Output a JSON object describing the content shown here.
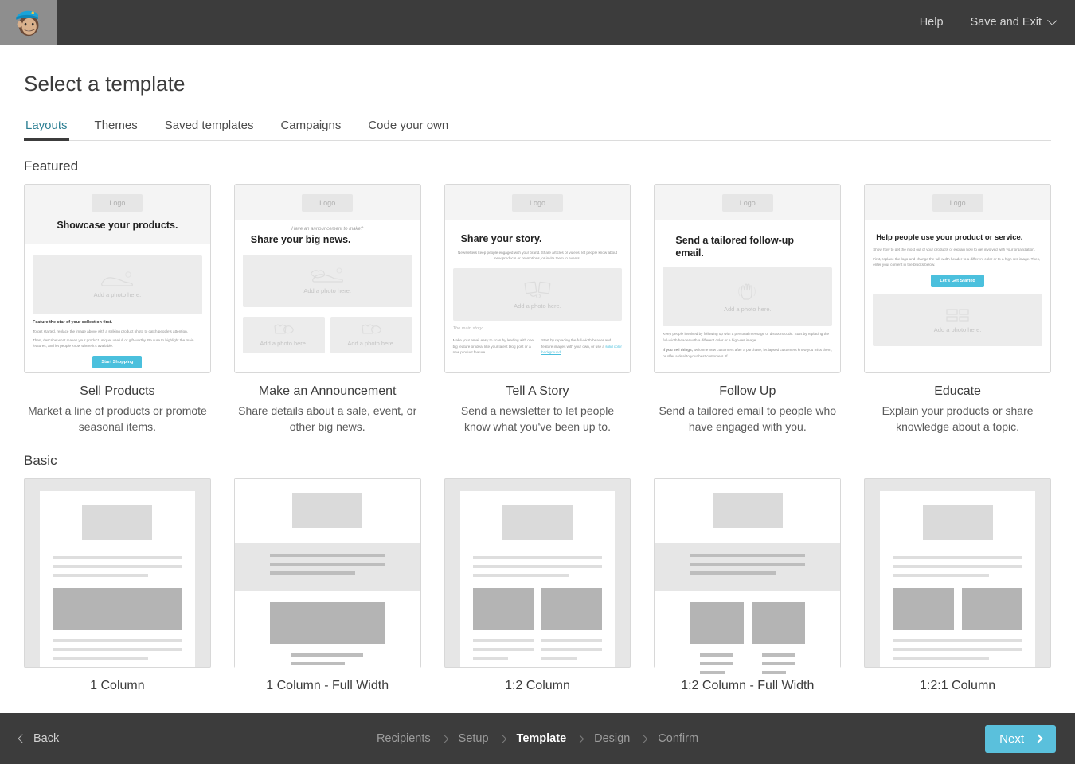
{
  "header": {
    "logo_icon": "mailchimp-freddie-logo",
    "help_label": "Help",
    "save_exit_label": "Save and Exit"
  },
  "page_title": "Select a template",
  "tabs": [
    {
      "label": "Layouts",
      "active": true
    },
    {
      "label": "Themes",
      "active": false
    },
    {
      "label": "Saved templates",
      "active": false
    },
    {
      "label": "Campaigns",
      "active": false
    },
    {
      "label": "Code your own",
      "active": false
    }
  ],
  "sections": {
    "featured": {
      "title": "Featured",
      "items": [
        {
          "name": "Sell Products",
          "description": "Market a line of products or promote seasonal items.",
          "preview": {
            "logo": "Logo",
            "eyebrow": "",
            "headline": "Showcase your products.",
            "photo_caption": "Add a photo here.",
            "body_heading": "Feature the star of your collection first.",
            "body_1": "To get started, replace the image above with a striking product photo to catch people's attention.",
            "body_2": "Then, describe what makes your product unique, useful, or gift-worthy. Be sure to highlight the main features, and let people know where it's available.",
            "button": "Start Shopping"
          }
        },
        {
          "name": "Make an Announcement",
          "description": "Share details about a sale, event, or other big news.",
          "preview": {
            "logo": "Logo",
            "eyebrow": "Have an announcement to make?",
            "headline": "Share your big news.",
            "photo_caption": "Add a photo here.",
            "photo_caption_left": "Add a photo here.",
            "photo_caption_right": "Add a photo here."
          }
        },
        {
          "name": "Tell A Story",
          "description": "Send a newsletter to let people know what you've been up to.",
          "preview": {
            "logo": "Logo",
            "headline": "Share your story.",
            "intro": "Newsletters keep people engaged with your brand. Share articles or videos, let people know about new products or promotions, or invite them to events.",
            "photo_caption": "Add a photo here.",
            "section_label": "The main story",
            "col_left": "Make your email easy to scan by leading with one big feature or idea, like your latest blog post or a new product feature.",
            "col_right_pre": "Start by replacing the full-width header and feature images with your own, or use a ",
            "col_right_link": "solid color background",
            "col_right_post": "."
          }
        },
        {
          "name": "Follow Up",
          "description": "Send a tailored email to people who have engaged with you.",
          "preview": {
            "logo": "Logo",
            "headline": "Send a tailored follow-up email.",
            "photo_caption": "Add a photo here.",
            "body_1": "Keep people involved by following up with a personal message or discount code. Start by replacing the full-width header with a different color or a high-res image.",
            "body_2_bold": "If you sell things,",
            "body_2": " welcome new customers after a purchase, let lapsed customers know you miss them, or offer a deal to your best customers. If"
          }
        },
        {
          "name": "Educate",
          "description": "Explain your products or share knowledge about a topic.",
          "preview": {
            "logo": "Logo",
            "headline": "Help people use your product or service.",
            "body_1": "Show how to get the most out of your products or explain how to get involved with your organization.",
            "body_2": "First, replace the logo and change the full-width header to a different color or to a high-res image. Then, enter your content in the blocks below.",
            "button": "Let's Get Started",
            "photo_caption": "Add a photo here."
          }
        }
      ]
    },
    "basic": {
      "title": "Basic",
      "items": [
        {
          "name": "1 Column",
          "variant": "boxed",
          "columns": 1
        },
        {
          "name": "1 Column - Full Width",
          "variant": "full",
          "columns": 1
        },
        {
          "name": "1:2 Column",
          "variant": "boxed",
          "columns": 2
        },
        {
          "name": "1:2 Column - Full Width",
          "variant": "full",
          "columns": 2
        },
        {
          "name": "1:2:1 Column",
          "variant": "boxed",
          "columns": 2
        }
      ]
    }
  },
  "footer": {
    "back_label": "Back",
    "steps": [
      {
        "label": "Recipients",
        "active": false
      },
      {
        "label": "Setup",
        "active": false
      },
      {
        "label": "Template",
        "active": true
      },
      {
        "label": "Design",
        "active": false
      },
      {
        "label": "Confirm",
        "active": false
      }
    ],
    "next_label": "Next"
  },
  "colors": {
    "accent_cyan": "#5ac0dc",
    "tab_active_teal": "#2c7f93",
    "chrome_dark": "#3c3c3c"
  }
}
